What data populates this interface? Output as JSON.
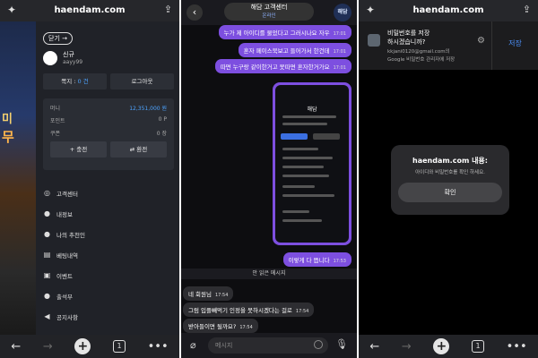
{
  "browser": {
    "url": "haendam.com",
    "tab_count": "1"
  },
  "menu": {
    "close_label": "닫기 →",
    "profile_name": "신규",
    "profile_id": "aayy99",
    "notes_label": "쪽지 : ",
    "notes_count": "0 건",
    "logout_label": "로그아웃",
    "wallet": {
      "money_label": "머니",
      "money_value": "12,351,000 원",
      "points_label": "포인트",
      "points_value": "0 P",
      "coupon_label": "쿠폰",
      "coupon_value": "0 장",
      "charge_label": "+ 충전",
      "withdraw_label": "⇄ 환전"
    },
    "items": [
      {
        "label": "고객센터",
        "icon": "headset-icon"
      },
      {
        "label": "내정보",
        "icon": "user-icon"
      },
      {
        "label": "나의 추천인",
        "icon": "users-icon"
      },
      {
        "label": "베팅내역",
        "icon": "receipt-icon"
      },
      {
        "label": "이벤트",
        "icon": "gift-icon"
      },
      {
        "label": "출석부",
        "icon": "user-check-icon"
      },
      {
        "label": "공지사항",
        "icon": "megaphone-icon"
      }
    ]
  },
  "chat": {
    "title": "해담 고객센터",
    "status": "온라인",
    "avatar_text": "해담",
    "messages": [
      {
        "text": "누가 제 아이디를 물었다고 그러시나요 자우",
        "time": "17:01"
      },
      {
        "text": "혼자 페이스북보고 들어가서 한건데",
        "time": "17:01"
      },
      {
        "text": "따면 누구랑 같이한거고 못따면 혼자한거가요",
        "time": "17:01"
      },
      {
        "text": "이렇게 다 뜹니다",
        "time": "17:53"
      },
      {
        "text": "네 회원님",
        "time": "17:54"
      },
      {
        "text": "그럼 입플빼먹기 인정을 못하시겠다는 걸로",
        "time": "17:54"
      },
      {
        "text": "받아들이면 될까요?",
        "time": "17:54"
      }
    ],
    "screenshot_title": "해담",
    "unread_divider": "안 읽은 메시지",
    "input_placeholder": "메시지"
  },
  "password_prompt": {
    "title": "비밀번호를 저장\n하시겠습니까?",
    "subtitle": "kkjani0120@gmail.com의\nGoogle 비밀번호 관리자에 저장",
    "save_label": "저장"
  },
  "dialog": {
    "title": "haendam.com 내용:",
    "message": "아이디와 비밀번호를 확인 하세요.",
    "ok_label": "확인"
  }
}
